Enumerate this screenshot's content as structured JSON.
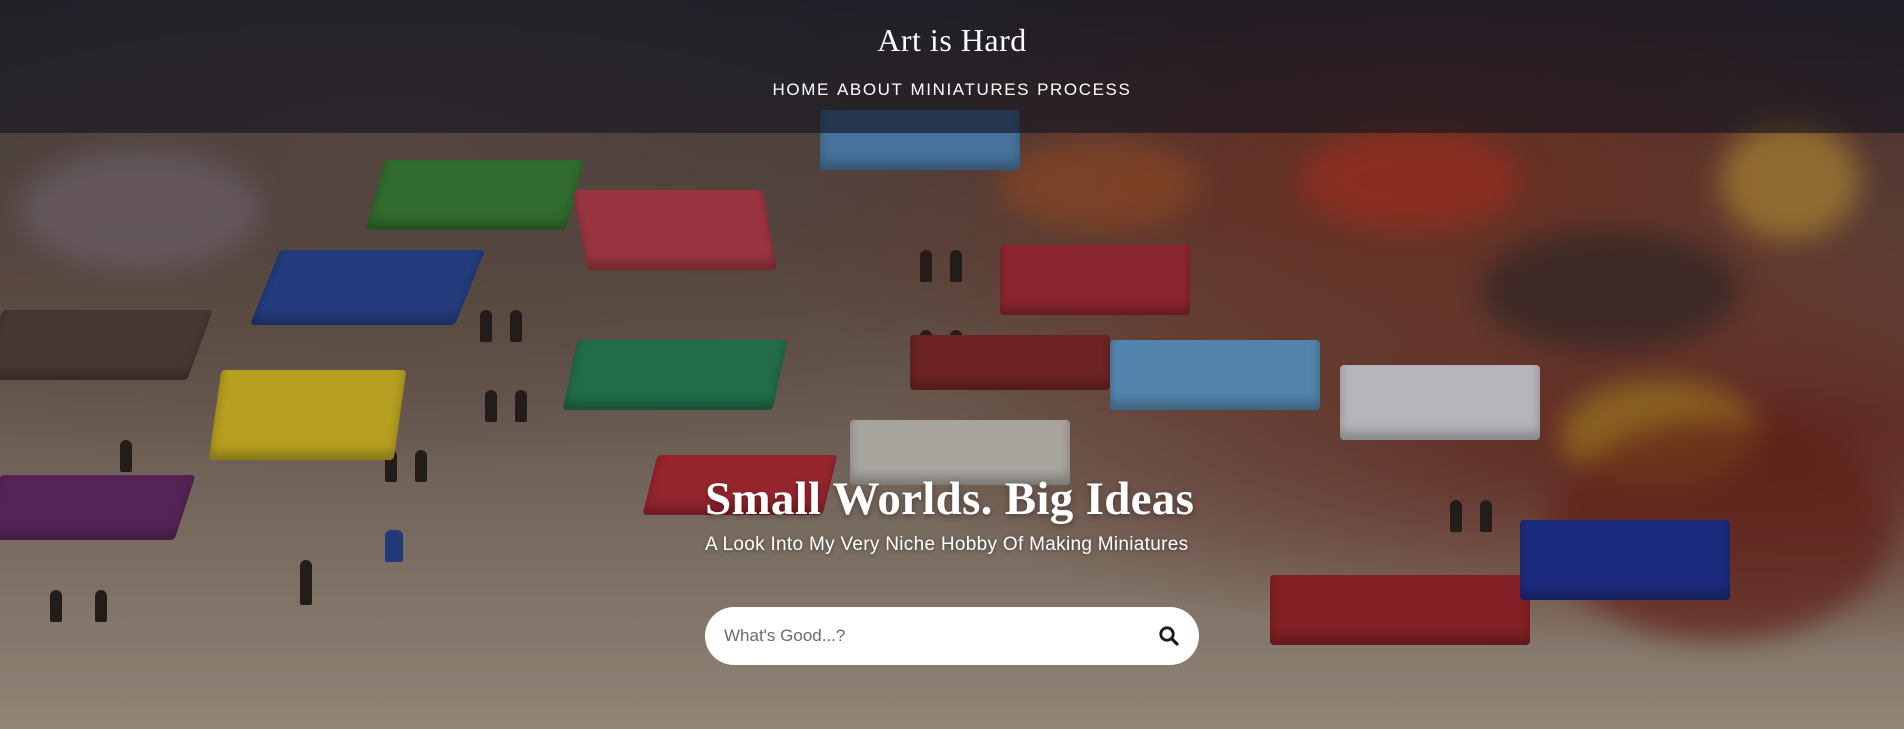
{
  "site": {
    "title": "Art is Hard"
  },
  "nav": {
    "items": [
      "HOME",
      "ABOUT",
      "MINIATURES",
      "PROCESS"
    ]
  },
  "hero": {
    "heading": "Small Worlds. Big Ideas",
    "subheading": "A Look Into My Very Niche Hobby Of Making Miniatures"
  },
  "search": {
    "placeholder": "What's Good...?",
    "value": "",
    "icon": "search-icon"
  },
  "colors": {
    "header_bg": "#12141e",
    "text": "#ffffff",
    "search_bg": "#ffffff"
  }
}
